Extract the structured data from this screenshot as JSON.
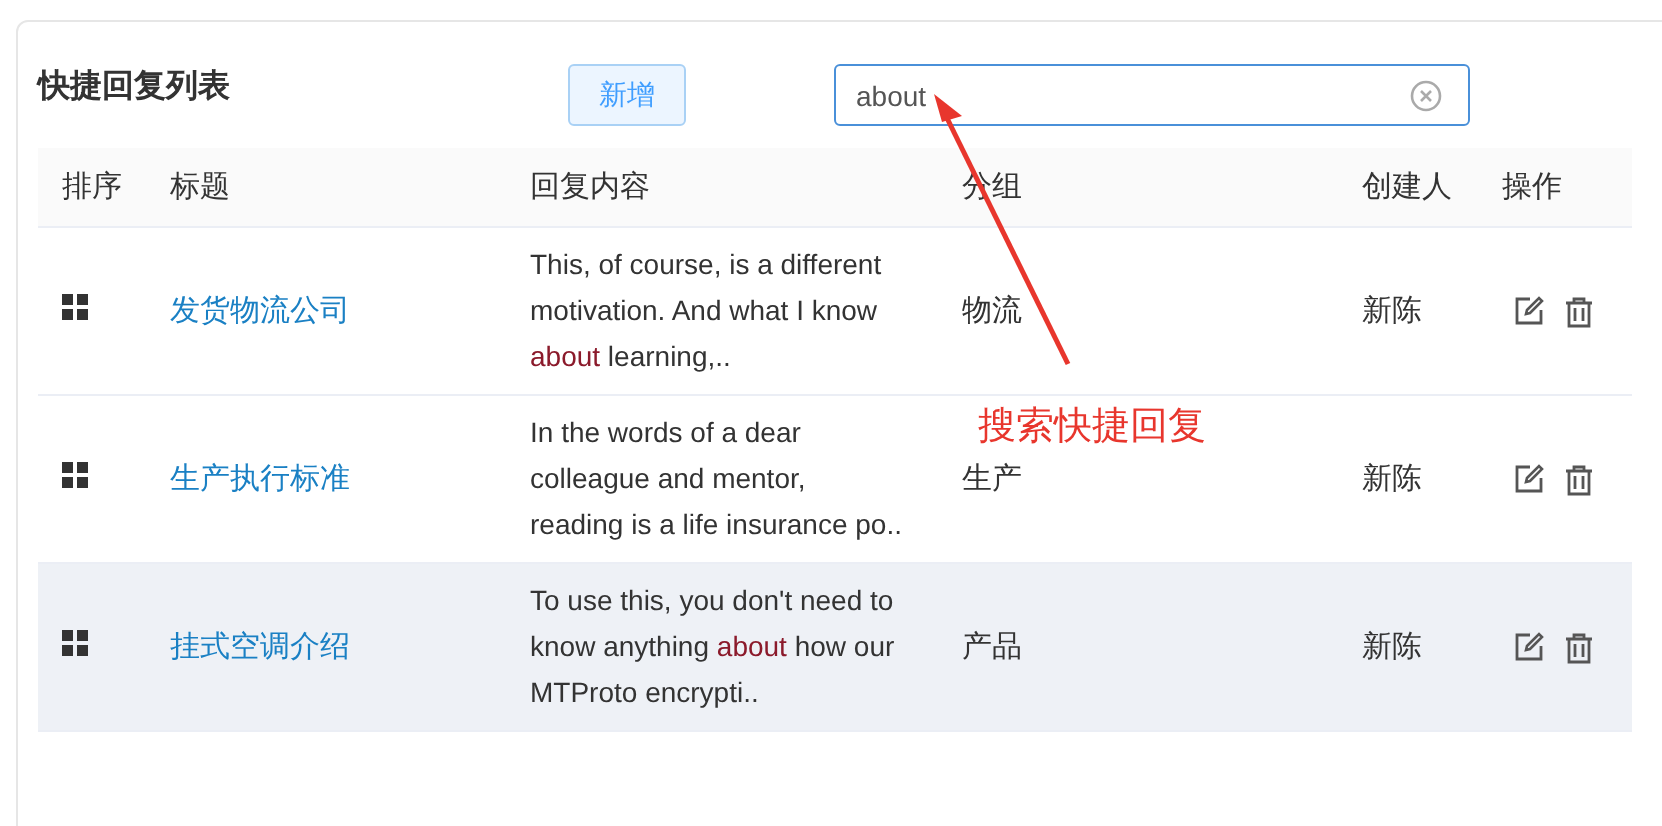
{
  "title": "快捷回复列表",
  "add_button": "新增",
  "search": {
    "value": "about"
  },
  "columns": [
    "排序",
    "标题",
    "回复内容",
    "分组",
    "创建人",
    "操作"
  ],
  "rows": [
    {
      "title": "发货物流公司",
      "content": [
        {
          "text": "This, of course, is a different motivation. And what I know ",
          "highlight": false
        },
        {
          "text": "about",
          "highlight": true
        },
        {
          "text": " learning,..",
          "highlight": false
        }
      ],
      "group": "物流",
      "creator": "新陈",
      "selected": false
    },
    {
      "title": "生产执行标准",
      "content": [
        {
          "text": "In the words of a dear colleague and mentor, reading is a life insurance po..",
          "highlight": false
        }
      ],
      "group": "生产",
      "creator": "新陈",
      "selected": false
    },
    {
      "title": "挂式空调介绍",
      "content": [
        {
          "text": "To use this, you don't need to know anything ",
          "highlight": false
        },
        {
          "text": "about",
          "highlight": true
        },
        {
          "text": " how our MTProto encrypti..",
          "highlight": false
        }
      ],
      "group": "产品",
      "creator": "新陈",
      "selected": true
    }
  ],
  "annotation": "搜索快捷回复"
}
